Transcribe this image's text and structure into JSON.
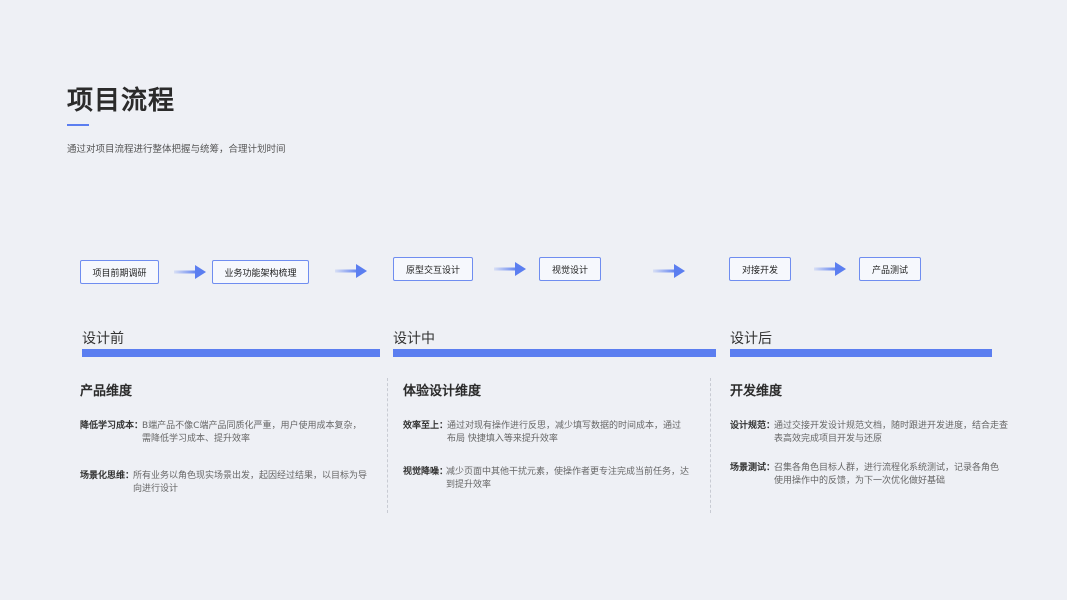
{
  "header": {
    "title": "项目流程",
    "subtitle": "通过对项目流程进行整体把握与统筹，合理计划时间"
  },
  "flow": {
    "steps": [
      "项目前期调研",
      "业务功能架构梳理",
      "原型交互设计",
      "视觉设计",
      "对接开发",
      "产品测试"
    ]
  },
  "phases": [
    {
      "label": "设计前",
      "dimension": "产品维度",
      "items": [
        {
          "key": "降低学习成本：",
          "text": "B端产品不像C端产品同质化严重，用户使用成本复杂，需降低学习成本、提升效率"
        },
        {
          "key": "场景化思维：",
          "text": "所有业务以角色现实场景出发，起因经过结果，以目标为导向进行设计"
        }
      ]
    },
    {
      "label": "设计中",
      "dimension": "体验设计维度",
      "items": [
        {
          "key": "效率至上：",
          "text": "通过对现有操作进行反思，减少填写数据的时间成本，通过布局 快捷填入等来提升效率"
        },
        {
          "key": "视觉降噪：",
          "text": "减少页面中其他干扰元素，使操作者更专注完成当前任务，达到提升效率"
        }
      ]
    },
    {
      "label": "设计后",
      "dimension": "开发维度",
      "items": [
        {
          "key": "设计规范：",
          "text": "通过交接开发设计规范文档，随时跟进开发进度，结合走查表高效完成项目开发与还原"
        },
        {
          "key": "场景测试：",
          "text": "召集各角色目标人群，进行流程化系统测试，记录各角色使用操作中的反馈，为下一次优化做好基础"
        }
      ]
    }
  ],
  "colors": {
    "accent": "#5b7ef0",
    "background": "#eef0f5"
  }
}
